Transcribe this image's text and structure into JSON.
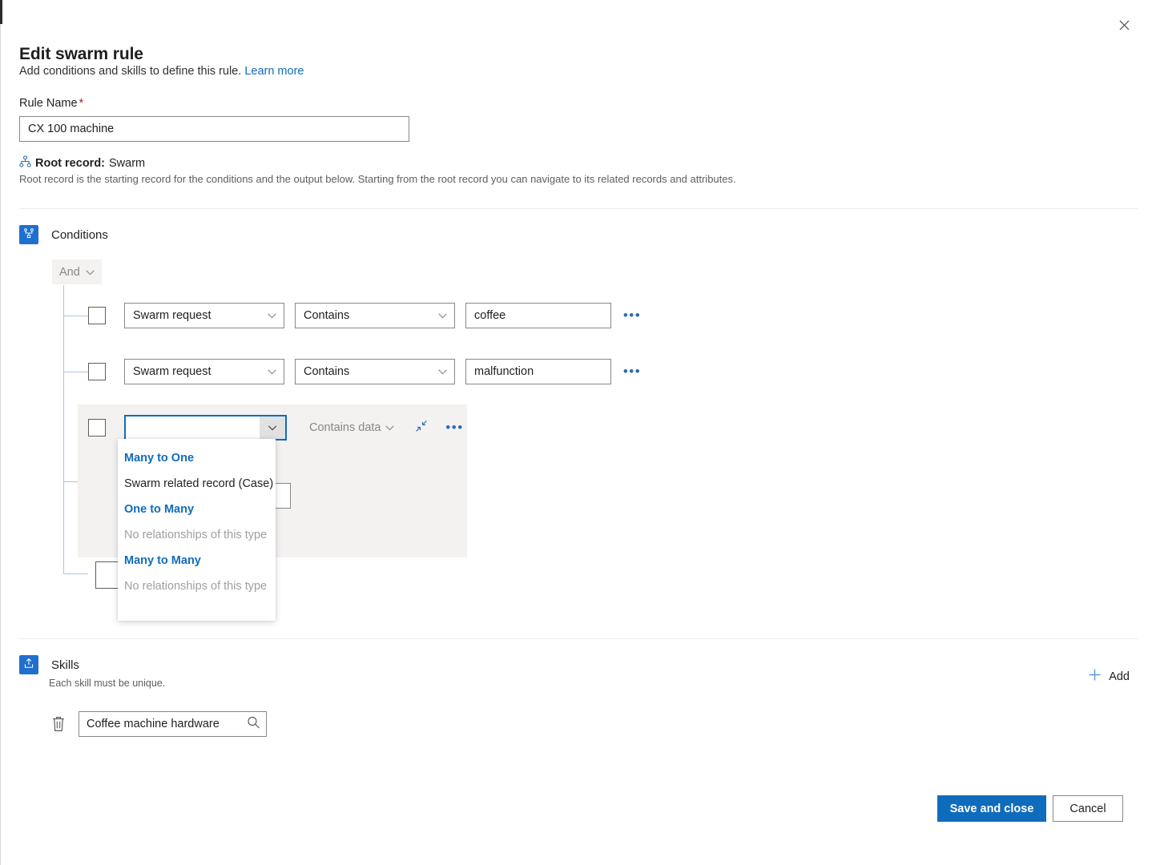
{
  "window": {
    "close_label": "Close"
  },
  "header": {
    "title": "Edit swarm rule",
    "subtitle": "Add conditions and skills to define this rule.",
    "learn_more": "Learn more"
  },
  "rule_name": {
    "label": "Rule Name",
    "required_marker": "*",
    "value": "CX 100 machine",
    "placeholder": ""
  },
  "root_record": {
    "label": "Root record:",
    "value": "Swarm",
    "help": "Root record is the starting record for the conditions and the output below. Starting from the root record you can navigate to its related records and attributes."
  },
  "conditions": {
    "title": "Conditions",
    "group_operator": "And",
    "rows": [
      {
        "attribute": "Swarm request",
        "operator": "Contains",
        "value": "coffee",
        "more": "•••"
      },
      {
        "attribute": "Swarm request",
        "operator": "Contains",
        "value": "malfunction",
        "more": "•••"
      }
    ],
    "active_row": {
      "attribute": "",
      "attribute_placeholder": "",
      "operator": "Contains data",
      "more": "•••"
    },
    "dropdown": {
      "groups": [
        {
          "header": "Many to One",
          "items": [
            "Swarm related record (Case)"
          ],
          "empty": null
        },
        {
          "header": "One to Many",
          "items": [],
          "empty": "No relationships of this type"
        },
        {
          "header": "Many to Many",
          "items": [],
          "empty": "No relationships of this type"
        }
      ]
    }
  },
  "skills": {
    "title": "Skills",
    "help": "Each skill must be unique.",
    "add_label": "Add",
    "items": [
      {
        "value": "Coffee machine hardware"
      }
    ]
  },
  "footer": {
    "save_label": "Save and close",
    "cancel_label": "Cancel"
  },
  "colors": {
    "accent": "#0f6cbd",
    "section_icon_bg": "#1f6fd0",
    "tree_line": "#a9c7e8",
    "group_bg": "#f3f2f1",
    "required": "#a4262c"
  }
}
